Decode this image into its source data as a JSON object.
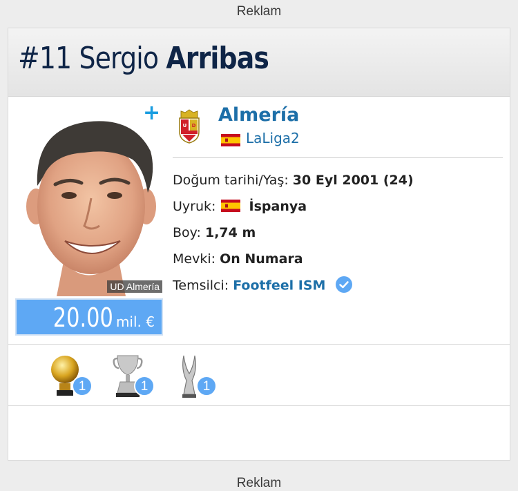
{
  "ads": {
    "top": "Reklam",
    "bottom": "Reklam"
  },
  "player": {
    "number": "#11",
    "first_name": "Sergio",
    "last_name": "Arribas",
    "club_caption": "UD Almería",
    "market_value": "20.00",
    "market_value_unit": "mil. €"
  },
  "club": {
    "name": "Almería",
    "league": "LaLiga2",
    "logo_text": "U.D. ALMERIA"
  },
  "info": {
    "birth_label": "Doğum tarihi/Yaş:",
    "birth_value": "30 Eyl 2001 (24)",
    "nationality_label": "Uyruk:",
    "nationality_value": "İspanya",
    "height_label": "Boy:",
    "height_value": "1,74 m",
    "position_label": "Mevki:",
    "position_value": "On Numara",
    "agent_label": "Temsilci:",
    "agent_value": "Footfeel ISM"
  },
  "trophies": [
    {
      "icon": "golden-ball-icon",
      "count": "1"
    },
    {
      "icon": "cup-trophy-icon",
      "count": "1"
    },
    {
      "icon": "silver-trophy-icon",
      "count": "1"
    }
  ],
  "colors": {
    "title": "#0f2547",
    "link": "#1d6fa8",
    "accent": "#5ea8f4"
  }
}
